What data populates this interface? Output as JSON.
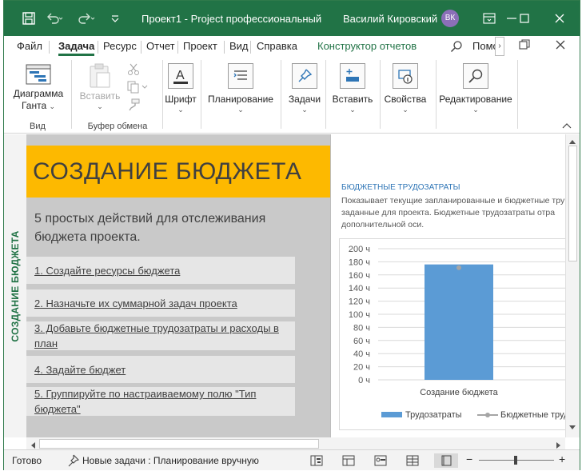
{
  "titlebar": {
    "title": "Проект1  -  Project профессиональный",
    "user": "Василий Кировский",
    "avatar": "ВК",
    "colors": {
      "brand": "#217346",
      "avatar": "#8b6fb8"
    }
  },
  "menu": {
    "file": "Файл",
    "task": "Задача",
    "resource": "Ресурс",
    "report": "Отчет",
    "project": "Проект",
    "view": "Вид",
    "help": "Справка",
    "report_designer": "Конструктор отчетов",
    "search_placeholder": "Помо"
  },
  "ribbon": {
    "gantt_label_1": "Диаграмма",
    "gantt_label_2": "Ганта",
    "group_view": "Вид",
    "paste": "Вставить",
    "group_clipboard": "Буфер обмена",
    "font": "Шрифт",
    "schedule": "Планирование",
    "tasks": "Задачи",
    "insert": "Вставить",
    "properties": "Свойства",
    "editing": "Редактирование"
  },
  "report": {
    "side_label": "СОЗДАНИЕ БЮДЖЕТА",
    "banner": "СОЗДАНИЕ БЮДЖЕТА",
    "intro": "5 простых действий для отслеживания бюджета проекта.",
    "steps": [
      "1. Создайте ресурсы бюджета",
      "2. Назначьте их суммарной задач проекта",
      "3. Добавьте бюджетные трудозатраты и расходы в план",
      "4. Задайте бюджет",
      "5. Группируйте по настраиваемому полю \"Тип бюджета\""
    ],
    "panel_title": "БЮДЖЕТНЫЕ ТРУДОЗАТРАТЫ",
    "panel_desc_1": "Показывает текущие запланированные и бюджетные тру",
    "panel_desc_2": "заданные для проекта. Бюджетные трудозатраты отра",
    "panel_desc_3": "дополнительной оси."
  },
  "chart_data": {
    "type": "bar",
    "categories": [
      "Создание бюджета"
    ],
    "series": [
      {
        "name": "Трудозатраты",
        "values": [
          176
        ],
        "color": "#5b9bd5"
      },
      {
        "name": "Бюджетные труд",
        "values": [
          171
        ],
        "color": "#a5a5a5",
        "render": "line-marker"
      }
    ],
    "y_tick_labels": [
      "0 ч",
      "20 ч",
      "40 ч",
      "60 ч",
      "80 ч",
      "100 ч",
      "120 ч",
      "140 ч",
      "160 ч",
      "180 ч",
      "200 ч"
    ],
    "ylim": [
      0,
      200
    ],
    "grid": true,
    "legend": "bottom"
  },
  "status": {
    "ready": "Готово",
    "new_tasks": "Новые задачи : Планирование вручную"
  }
}
